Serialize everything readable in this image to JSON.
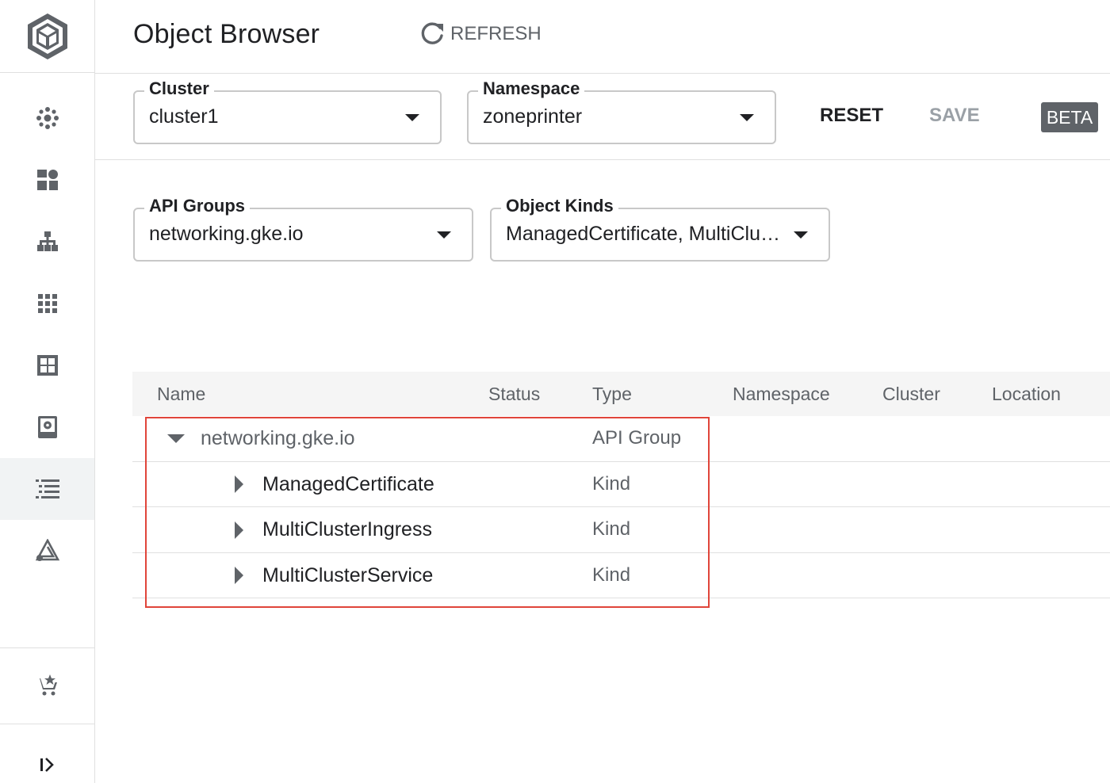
{
  "header": {
    "title": "Object Browser",
    "refresh_label": "REFRESH"
  },
  "filters": {
    "cluster": {
      "label": "Cluster",
      "value": "cluster1"
    },
    "namespace": {
      "label": "Namespace",
      "value": "zoneprinter"
    },
    "api_groups": {
      "label": "API Groups",
      "value": "networking.gke.io"
    },
    "object_kinds": {
      "label": "Object Kinds",
      "value": "ManagedCertificate, MultiClu…"
    },
    "reset_label": "RESET",
    "save_label": "SAVE",
    "beta_badge": "BETA"
  },
  "sidebar": {
    "icons": [
      "gke-logo-icon",
      "clusters-icon",
      "workloads-icon",
      "services-icon",
      "applications-icon",
      "configuration-icon",
      "storage-icon",
      "object-browser-icon",
      "migrate-icon",
      "marketplace-icon",
      "expand-sidebar-icon"
    ],
    "active_item": "object-browser"
  },
  "table": {
    "columns": [
      "Name",
      "Status",
      "Type",
      "Namespace",
      "Cluster",
      "Location"
    ],
    "rows": [
      {
        "name": "networking.gke.io",
        "type": "API Group"
      },
      {
        "name": "ManagedCertificate",
        "type": "Kind"
      },
      {
        "name": "MultiClusterIngress",
        "type": "Kind"
      },
      {
        "name": "MultiClusterService",
        "type": "Kind"
      }
    ]
  },
  "colors": {
    "accent_text": "#202124",
    "muted_text": "#5f6368",
    "highlight_border": "#e0453a",
    "beta_bg": "#5f6368"
  }
}
